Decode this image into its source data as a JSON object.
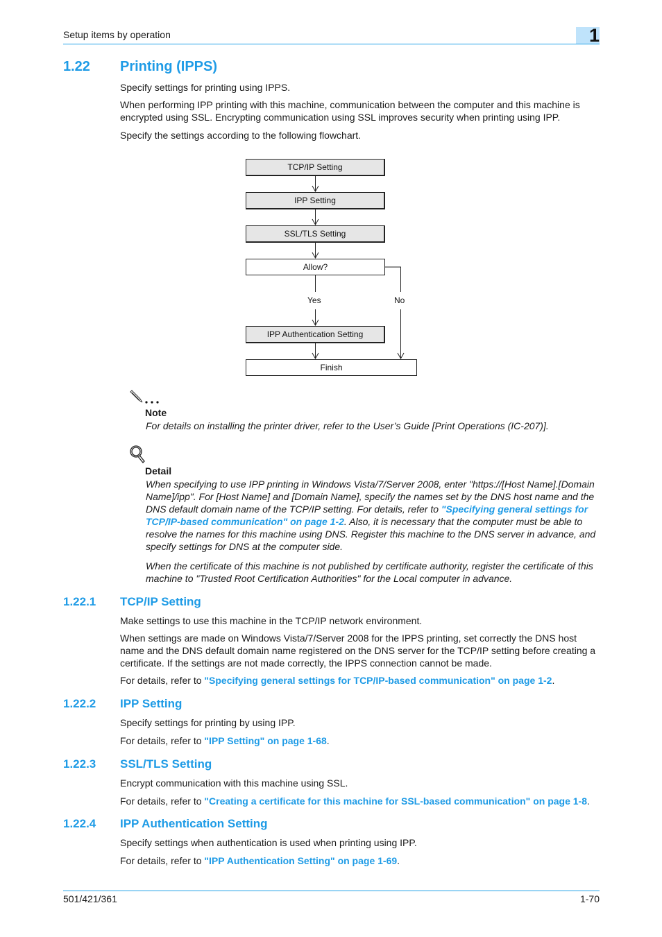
{
  "header": {
    "running_title": "Setup items by operation",
    "chapter_number": "1"
  },
  "section": {
    "number": "1.22",
    "title": "Printing (IPPS)",
    "paragraphs": [
      "Specify settings for printing using IPPS.",
      "When performing IPP printing with this machine, communication between the computer and this machine is encrypted using SSL. Encrypting communication using SSL improves security when printing using IPP.",
      "Specify the settings according to the following flowchart."
    ]
  },
  "flowchart": {
    "nodes": [
      {
        "id": "tcpip",
        "label": "TCP/IP Setting"
      },
      {
        "id": "ipp",
        "label": "IPP Setting"
      },
      {
        "id": "ssltls",
        "label": "SSL/TLS Setting"
      },
      {
        "id": "allow",
        "label": "Allow?"
      },
      {
        "id": "ippauth",
        "label": "IPP Authentication Setting"
      },
      {
        "id": "finish",
        "label": "Finish"
      }
    ],
    "edge_labels": {
      "yes": "Yes",
      "no": "No"
    }
  },
  "note": {
    "icon": "pencil-note-icon",
    "title": "Note",
    "text": "For details on installing the printer driver, refer to the User’s Guide [Print Operations (IC-207)]."
  },
  "detail": {
    "icon": "magnifier-icon",
    "title": "Detail",
    "para1_before": "When specifying to use IPP printing in Windows Vista/7/Server 2008, enter \"https://[Host Name].[Domain Name]/ipp\". For [Host Name] and [Domain Name], specify the names set by the DNS host name and the DNS default domain name of the TCP/IP setting. For details, refer to ",
    "para1_link": "\"Specifying general settings for TCP/IP-based communication\" on page 1-2",
    "para1_after": ". Also, it is necessary that the computer must be able to resolve the names for this machine using DNS. Register this machine to the DNS server in advance, and specify settings for DNS at the computer side.",
    "para2": "When the certificate of this machine is not published by certificate authority, register the certificate of this machine to \"Trusted Root Certification Authorities\" for the Local computer in advance."
  },
  "subsections": [
    {
      "number": "1.22.1",
      "title": "TCP/IP Setting",
      "paragraphs": [
        "Make settings to use this machine in the TCP/IP network environment.",
        "When settings are made on Windows Vista/7/Server 2008 for the IPPS printing, set correctly the DNS host name and the DNS default domain name registered on the DNS server for the TCP/IP setting before creating a certificate. If the settings are not made correctly, the IPPS connection cannot be made."
      ],
      "ref_prefix": "For details, refer to ",
      "ref_link": "\"Specifying general settings for TCP/IP-based communication\" on page 1-2",
      "ref_suffix": "."
    },
    {
      "number": "1.22.2",
      "title": "IPP Setting",
      "paragraphs": [
        "Specify settings for printing by using IPP."
      ],
      "ref_prefix": "For details, refer to ",
      "ref_link": "\"IPP Setting\" on page 1-68",
      "ref_suffix": "."
    },
    {
      "number": "1.22.3",
      "title": "SSL/TLS Setting",
      "paragraphs": [
        "Encrypt communication with this machine using SSL."
      ],
      "ref_prefix": "For details, refer to ",
      "ref_link": "\"Creating a certificate for this machine for SSL-based communication\" on page 1-8",
      "ref_suffix": "."
    },
    {
      "number": "1.22.4",
      "title": "IPP Authentication Setting",
      "paragraphs": [
        "Specify settings when authentication is used when printing using IPP."
      ],
      "ref_prefix": "For details, refer to ",
      "ref_link": "\"IPP Authentication Setting\" on page 1-69",
      "ref_suffix": "."
    }
  ],
  "footer": {
    "model": "501/421/361",
    "page": "1-70"
  },
  "colors": {
    "accent": "#1e9be6",
    "chapter_tab": "#bfe3fb",
    "shaded_box": "#e6e6e6"
  }
}
